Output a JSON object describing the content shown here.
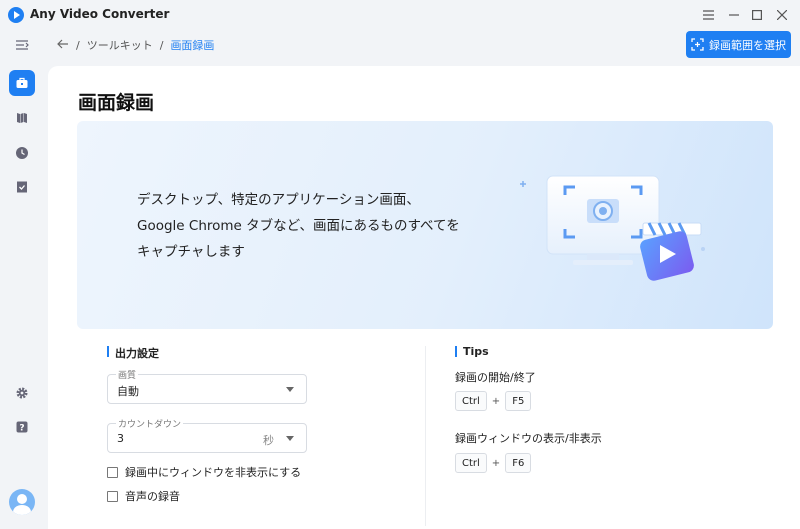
{
  "app": {
    "title": "Any Video Converter"
  },
  "window_controls": {
    "menu_icon": "menu-icon",
    "minimize_icon": "minimize-icon",
    "maximize_icon": "maximize-icon",
    "close_icon": "close-icon"
  },
  "sidebar": {
    "items": [
      {
        "name": "collapse",
        "icon": "collapse-icon",
        "active": false
      },
      {
        "name": "toolkit",
        "icon": "toolbox-icon",
        "active": true
      },
      {
        "name": "library",
        "icon": "library-icon",
        "active": false
      },
      {
        "name": "history",
        "icon": "clock-icon",
        "active": false
      },
      {
        "name": "tasks",
        "icon": "checklist-icon",
        "active": false
      },
      {
        "name": "settings",
        "icon": "gear-icon",
        "active": false
      },
      {
        "name": "help",
        "icon": "help-icon",
        "active": false
      }
    ],
    "avatar_icon": "user-avatar-icon"
  },
  "breadcrumb": {
    "parent": "ツールキット",
    "current": "画面録画",
    "separator": "/"
  },
  "header": {
    "select_area_button": "録画範囲を選択"
  },
  "main": {
    "title": "画面録画",
    "hero": {
      "description": "デスクトップ、特定のアプリケーション画面、Google Chrome タブなど、画面にあるものすべてをキャプチャします"
    }
  },
  "output_settings": {
    "title": "出力設定",
    "quality": {
      "label": "画質",
      "value": "自動"
    },
    "countdown": {
      "label": "カウントダウン",
      "value": "3",
      "unit": "秒"
    },
    "hide_window": {
      "label": "録画中にウィンドウを非表示にする",
      "checked": false
    },
    "record_audio": {
      "label": "音声の録音",
      "checked": false
    }
  },
  "tips": {
    "title": "Tips",
    "items": [
      {
        "label": "録画の開始/終了",
        "keys": [
          "Ctrl",
          "F5"
        ]
      },
      {
        "label": "録画ウィンドウの表示/非表示",
        "keys": [
          "Ctrl",
          "F6"
        ]
      }
    ],
    "plus": "+"
  },
  "colors": {
    "accent": "#1f7ff2"
  }
}
